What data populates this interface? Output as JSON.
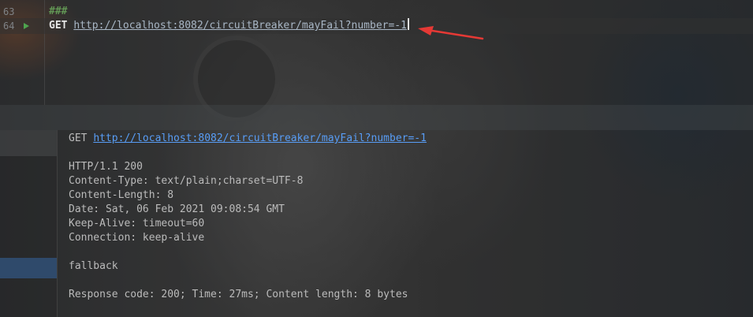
{
  "editor": {
    "lines": [
      {
        "number": "63",
        "text": "###"
      },
      {
        "number": "64",
        "method": "GET",
        "url": "http://localhost:8082/circuitBreaker/mayFail?number=-1"
      }
    ]
  },
  "response": {
    "request_method": "GET",
    "request_url": "http://localhost:8082/circuitBreaker/mayFail?number=-1",
    "status_line": "HTTP/1.1 200",
    "headers": [
      "Content-Type: text/plain;charset=UTF-8",
      "Content-Length: 8",
      "Date: Sat, 06 Feb 2021 09:08:54 GMT",
      "Keep-Alive: timeout=60",
      "Connection: keep-alive"
    ],
    "body": "fallback",
    "summary": "Response code: 200; Time: 27ms; Content length: 8 bytes"
  },
  "colors": {
    "annotation_arrow": "#e53935",
    "run_icon": "#4ea44e",
    "link": "#589df6"
  },
  "icons": {
    "run": "run-icon",
    "annotation": "red-arrow-icon"
  }
}
